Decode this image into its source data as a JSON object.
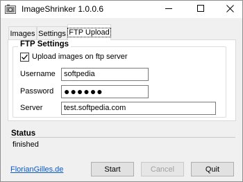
{
  "window": {
    "title": "ImageShrinker 1.0.0.6"
  },
  "tabs": [
    {
      "label": "Images"
    },
    {
      "label": "Settings"
    },
    {
      "label": "FTP Upload",
      "active": true
    }
  ],
  "ftp": {
    "group_title": "FTP Settings",
    "upload_checkbox_label": "Upload images on ftp server",
    "upload_checked": true,
    "username_label": "Username",
    "username_value": "softpedia",
    "password_label": "Password",
    "password_value": "●●●●●●",
    "server_label": "Server",
    "server_value": "test.softpedia.com"
  },
  "status": {
    "title": "Status",
    "text": "finished"
  },
  "footer": {
    "link": "FlorianGilles.de",
    "start_label": "Start",
    "cancel_label": "Cancel",
    "quit_label": "Quit"
  },
  "icons": {
    "app": "app-icon",
    "minimize": "minimize-icon",
    "maximize": "maximize-icon",
    "close": "close-icon",
    "check": "check-icon"
  },
  "colors": {
    "link": "#0b58c7",
    "background": "#f0f0f0",
    "panel": "#ffffff"
  }
}
